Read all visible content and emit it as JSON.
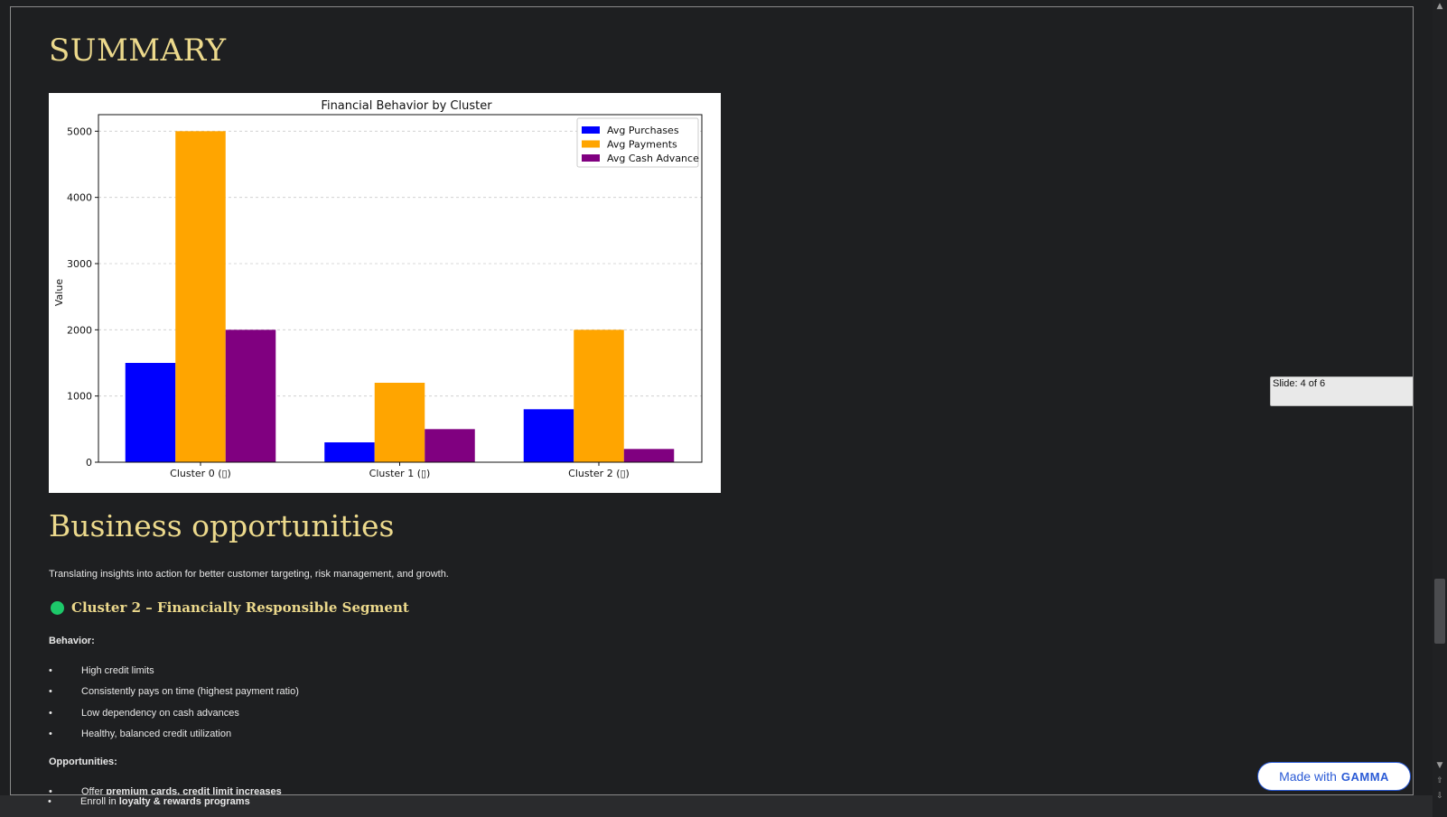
{
  "summary": {
    "title": "SUMMARY"
  },
  "chart_data": {
    "type": "bar",
    "title": "Financial Behavior by Cluster",
    "xlabel": "",
    "ylabel": "Value",
    "ylim": [
      0,
      5250
    ],
    "yticks": [
      0,
      1000,
      2000,
      3000,
      4000,
      5000
    ],
    "grid": true,
    "legend_position": "top-right",
    "categories": [
      "Cluster 0 (▯)",
      "Cluster 1 (▯)",
      "Cluster 2 (▯)"
    ],
    "series": [
      {
        "name": "Avg Purchases",
        "color": "#0000ff",
        "values": [
          1500,
          300,
          800
        ]
      },
      {
        "name": "Avg Payments",
        "color": "#ffa500",
        "values": [
          5000,
          1200,
          2000
        ]
      },
      {
        "name": "Avg Cash Advance",
        "color": "#800080",
        "values": [
          2000,
          500,
          200
        ]
      }
    ]
  },
  "business": {
    "heading": "Business opportunities",
    "intro": "Translating insights into action for better customer targeting, risk management, and growth.",
    "cluster_heading": "Cluster 2 – Financially Responsible Segment",
    "cluster_dot_color": "#1dc96a",
    "behavior_label": "Behavior:",
    "behavior_items": [
      "High credit limits",
      "Consistently pays on time (highest payment ratio)",
      "Low dependency on cash advances",
      "Healthy, balanced credit utilization"
    ],
    "opportunities_label": "Opportunities:",
    "opportunity_items": [
      {
        "prefix": "Offer ",
        "bold": "premium cards, credit limit increases"
      },
      {
        "prefix": "Enroll in ",
        "bold": "loyalty & rewards programs"
      }
    ],
    "bullet": "•"
  },
  "slide_indicator": {
    "text": "Slide: 4 of 6"
  },
  "badge": {
    "made_with": "Made with",
    "brand": "GAMMA"
  },
  "scrollbar": {
    "up": "▲",
    "down": "▼",
    "page_up": "⇧",
    "page_down": "⇩"
  },
  "colors": {
    "heading_gold": "#ecd98c",
    "background": "#1e1f21",
    "gamma_blue": "#2b5bd6"
  }
}
